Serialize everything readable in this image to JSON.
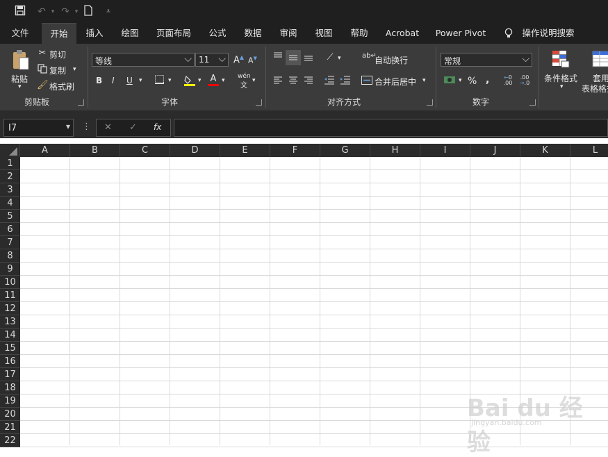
{
  "qat": {
    "icons": [
      "save-icon",
      "undo-icon",
      "redo-icon",
      "new-document-icon",
      "customize-qat-icon"
    ]
  },
  "tabs": [
    {
      "label": "文件"
    },
    {
      "label": "开始",
      "active": true
    },
    {
      "label": "插入"
    },
    {
      "label": "绘图"
    },
    {
      "label": "页面布局"
    },
    {
      "label": "公式"
    },
    {
      "label": "数据"
    },
    {
      "label": "审阅"
    },
    {
      "label": "视图"
    },
    {
      "label": "帮助"
    },
    {
      "label": "Acrobat"
    },
    {
      "label": "Power Pivot"
    },
    {
      "label": "操作说明搜索"
    }
  ],
  "ribbon": {
    "clipboard": {
      "paste": "粘贴",
      "cut": "剪切",
      "copy": "复制",
      "format_painter": "格式刷",
      "group_label": "剪贴板"
    },
    "font": {
      "font_name": "等线",
      "font_size": "11",
      "bold": "B",
      "italic": "I",
      "underline": "U",
      "phonetic": "wén",
      "group_label": "字体",
      "highlight_color": "#ffff00",
      "font_color": "#ff0000"
    },
    "alignment": {
      "wrap_text": "自动换行",
      "merge_center": "合并后居中",
      "group_label": "对齐方式"
    },
    "number": {
      "format": "常规",
      "percent": "%",
      "comma": ",",
      "group_label": "数字"
    },
    "styles": {
      "conditional_format": "条件格式",
      "format_as_table_top": "套用",
      "format_as_table_bottom": "表格格式"
    }
  },
  "formula_bar": {
    "name_box": "I7",
    "cancel": "✕",
    "enter": "✓",
    "fx": "fx",
    "value": ""
  },
  "sheet": {
    "columns": [
      "A",
      "B",
      "C",
      "D",
      "E",
      "F",
      "G",
      "H",
      "I",
      "J",
      "K",
      "L"
    ],
    "rows": [
      "1",
      "2",
      "3",
      "4",
      "5",
      "6",
      "7",
      "8",
      "9",
      "10",
      "11",
      "12",
      "13",
      "14",
      "15",
      "16",
      "17",
      "18",
      "19",
      "20",
      "21",
      "22"
    ]
  },
  "watermark": {
    "text": "Bai du 经验",
    "sub": "jingyan.baidu.com"
  }
}
